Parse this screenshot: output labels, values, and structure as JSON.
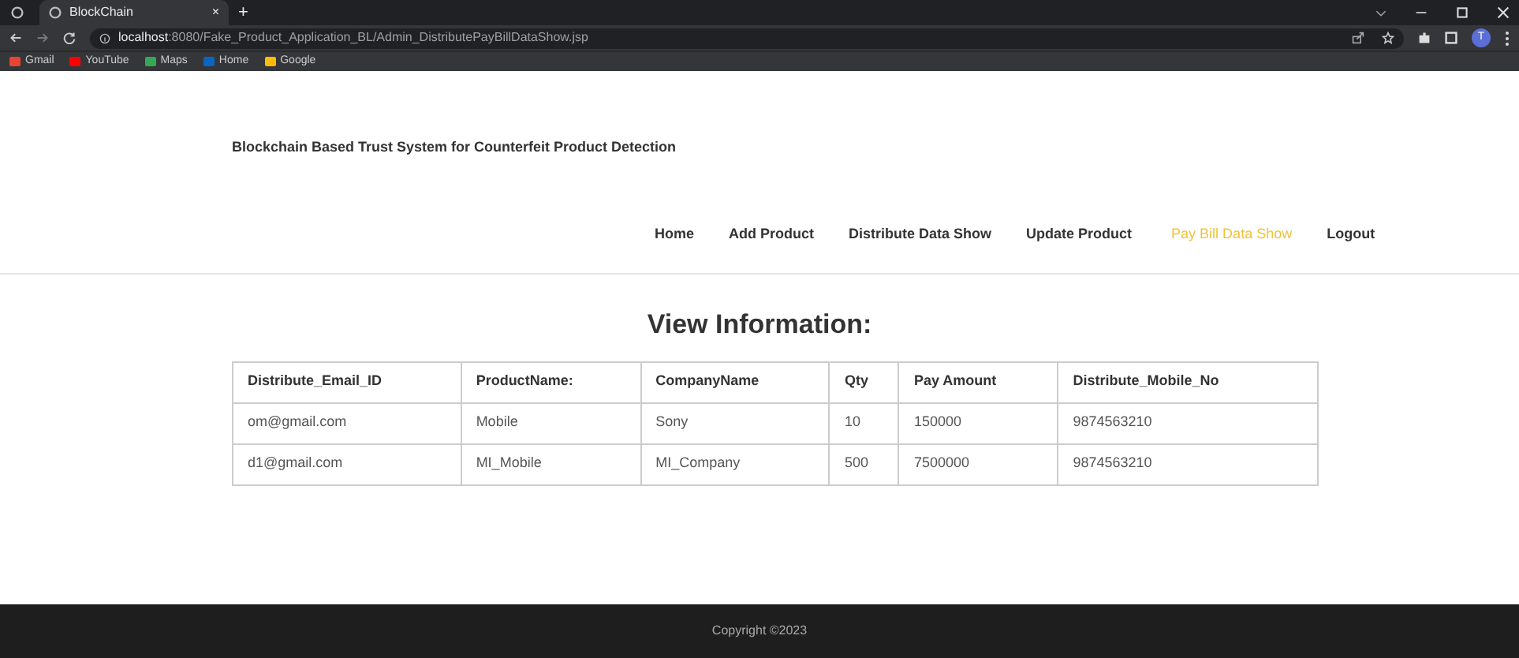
{
  "browser": {
    "tab": {
      "title": "BlockChain",
      "close": "×"
    },
    "new_tab": "+",
    "url_host": "localhost",
    "url_rest": ":8080/Fake_Product_Application_BL/Admin_DistributePayBillDataShow.jsp",
    "profile": "T",
    "bookmarks": [
      {
        "label": "Gmail",
        "color": "#ea4335"
      },
      {
        "label": "YouTube",
        "color": "#ff0000"
      },
      {
        "label": "Maps",
        "color": "#34a853"
      },
      {
        "label": "Home",
        "color": "#0a66c2"
      },
      {
        "label": "Google",
        "color": "#fbbc05"
      }
    ]
  },
  "site_title": "Blockchain Based Trust System for Counterfeit Product Detection",
  "nav": [
    {
      "label": "Home",
      "selected": false
    },
    {
      "label": "Add Product",
      "selected": false
    },
    {
      "label": "Distribute Data Show",
      "selected": false
    },
    {
      "label": "Update Product",
      "selected": false
    },
    {
      "label": "Pay Bill Data Show",
      "selected": true
    },
    {
      "label": "Logout",
      "selected": false
    }
  ],
  "heading": "View Information:",
  "table": {
    "columns": [
      "Distribute_Email_ID",
      "ProductName:",
      "CompanyName",
      "Qty",
      "Pay Amount",
      "Distribute_Mobile_No"
    ],
    "rows": [
      [
        "om@gmail.com",
        "Mobile",
        "Sony",
        "10",
        "150000",
        "9874563210"
      ],
      [
        "d1@gmail.com",
        "MI_Mobile",
        "MI_Company",
        "500",
        "7500000",
        "9874563210"
      ]
    ]
  },
  "footer": "Copyright ©2023"
}
